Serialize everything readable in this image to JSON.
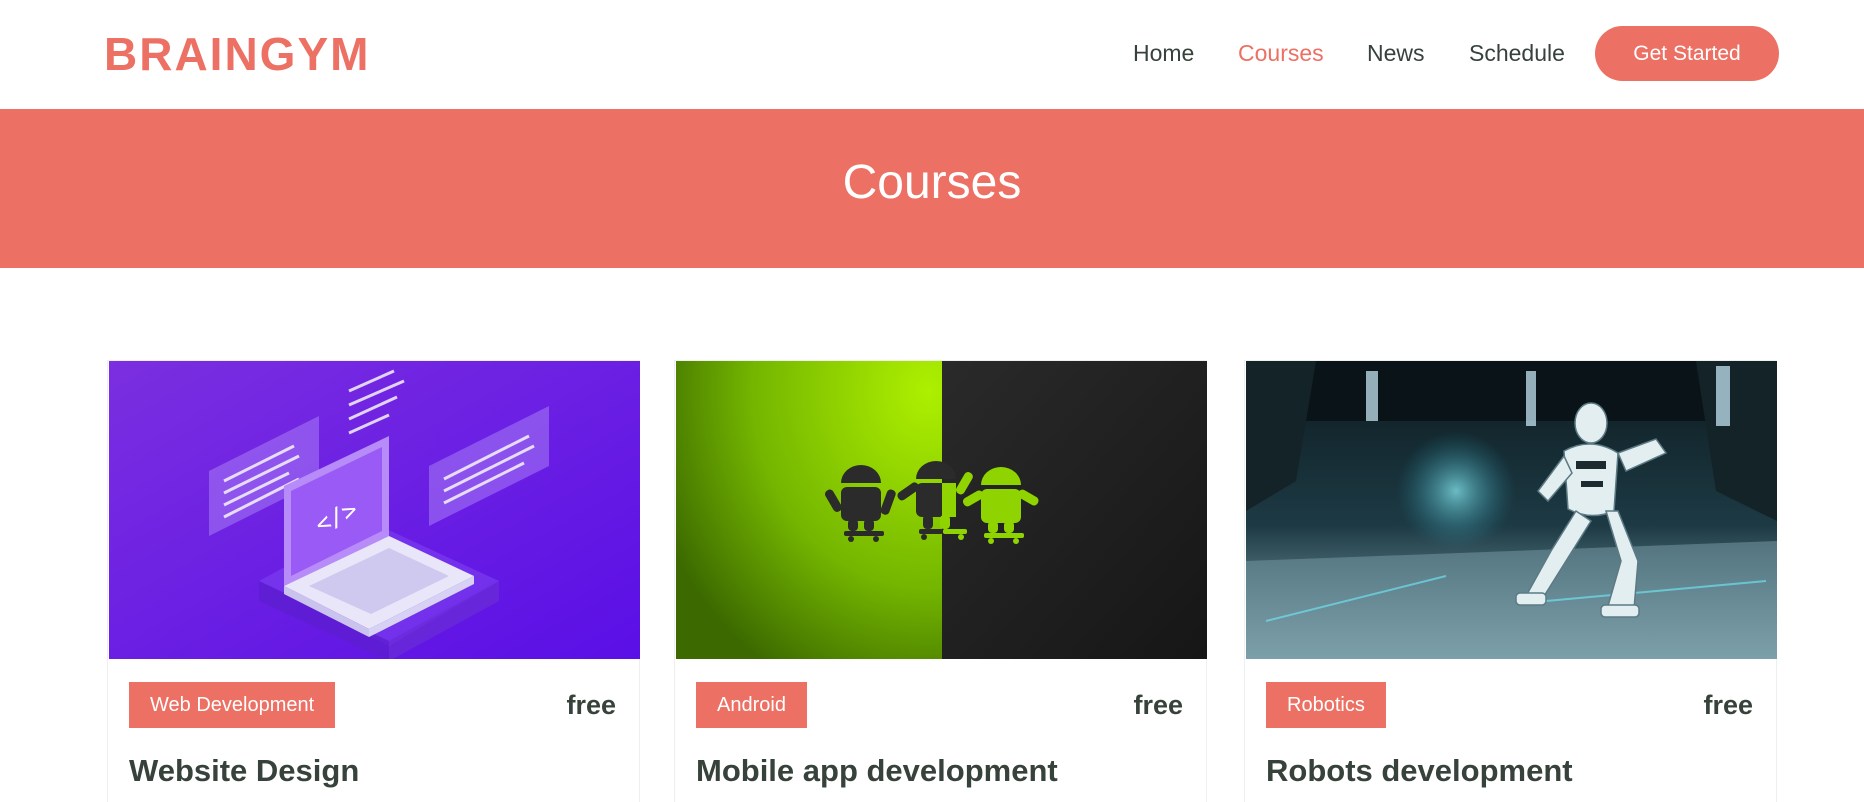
{
  "header": {
    "logo": "BRAINGYM",
    "nav": [
      "Home",
      "Courses",
      "News",
      "Schedule"
    ],
    "active_nav": "Courses",
    "cta": "Get Started"
  },
  "banner": {
    "title": "Courses"
  },
  "courses": [
    {
      "category": "Web Development",
      "price": "free",
      "title": "Website Design",
      "image": "laptop-code-illustration"
    },
    {
      "category": "Android",
      "price": "free",
      "title": "Mobile app development",
      "image": "android-robots-image"
    },
    {
      "category": "Robotics",
      "price": "free",
      "title": "Robots development",
      "image": "robot-image"
    }
  ],
  "colors": {
    "accent": "#ec7063",
    "text": "#37423b"
  }
}
